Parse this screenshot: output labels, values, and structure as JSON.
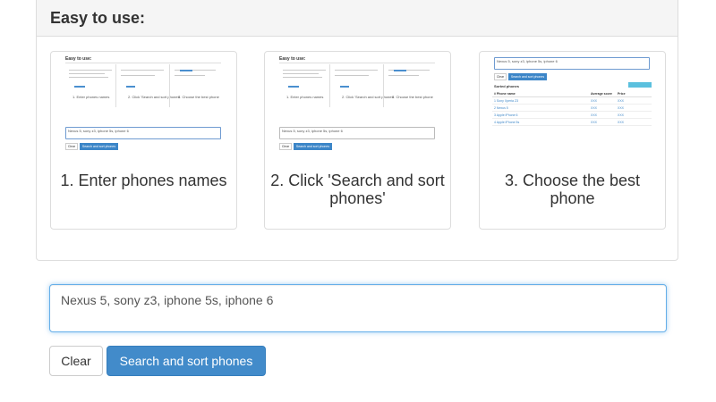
{
  "panel": {
    "title": "Easy to use:"
  },
  "steps": [
    {
      "caption": "1. Enter phones names"
    },
    {
      "caption": "2. Click 'Search and sort phones'"
    },
    {
      "caption": "3. Choose the best phone"
    }
  ],
  "search": {
    "value": "Nexus 5, sony z3, iphone 5s, iphone 6",
    "placeholder": ""
  },
  "buttons": {
    "clear_label": "Clear",
    "search_label": "Search and sort phones"
  },
  "colors": {
    "primary": "#428bca",
    "focus_border": "#66afe9",
    "panel_heading_bg": "#f5f5f5"
  }
}
